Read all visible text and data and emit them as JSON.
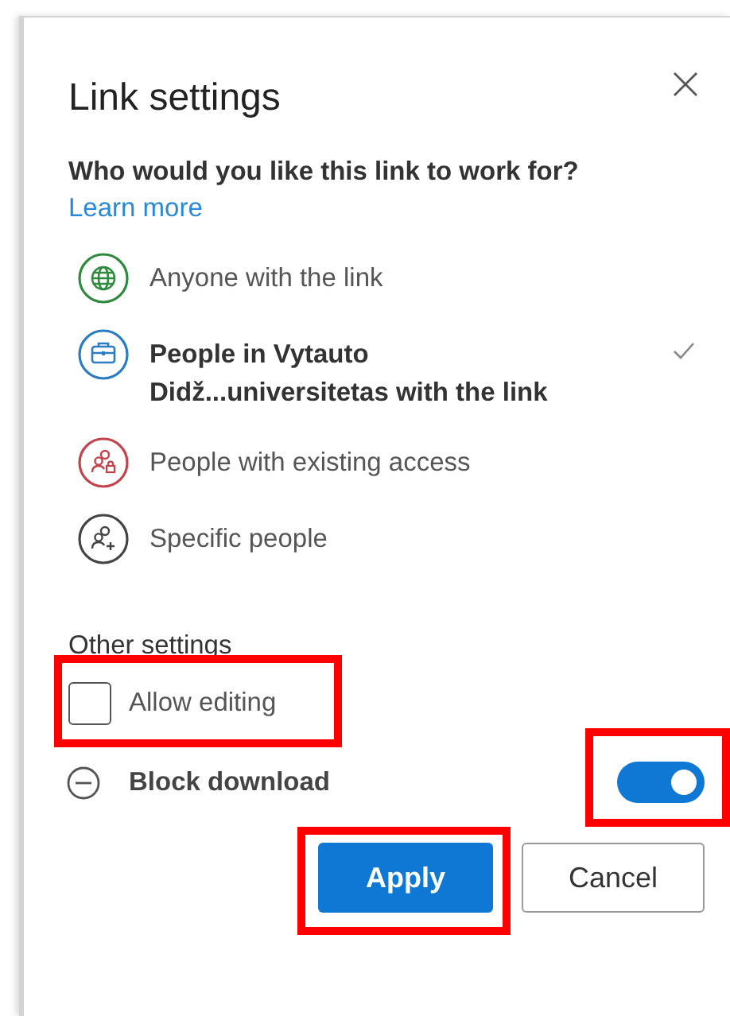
{
  "dialog": {
    "title": "Link settings",
    "question": "Who would you like this link to work for?",
    "learn_more": "Learn more",
    "options": [
      {
        "kind": "anyone",
        "label": "Anyone with the link",
        "selected": false,
        "color": "#2e8b3e"
      },
      {
        "kind": "organization",
        "label": "People in Vytauto Didž...universitetas with the link",
        "selected": true,
        "color": "#2b7cc1"
      },
      {
        "kind": "existing",
        "label": "People with existing access",
        "selected": false,
        "color": "#c4424b"
      },
      {
        "kind": "specific",
        "label": "Specific people",
        "selected": false,
        "color": "#444444"
      }
    ],
    "other_settings": {
      "heading": "Other settings",
      "allow_editing": {
        "label": "Allow editing",
        "checked": false,
        "highlighted": true
      },
      "block_download": {
        "label": "Block download",
        "on": true,
        "highlighted": true
      }
    },
    "buttons": [
      {
        "kind": "primary",
        "label": "Apply",
        "highlighted": true
      },
      {
        "kind": "secondary",
        "label": "Cancel",
        "highlighted": false
      }
    ]
  }
}
